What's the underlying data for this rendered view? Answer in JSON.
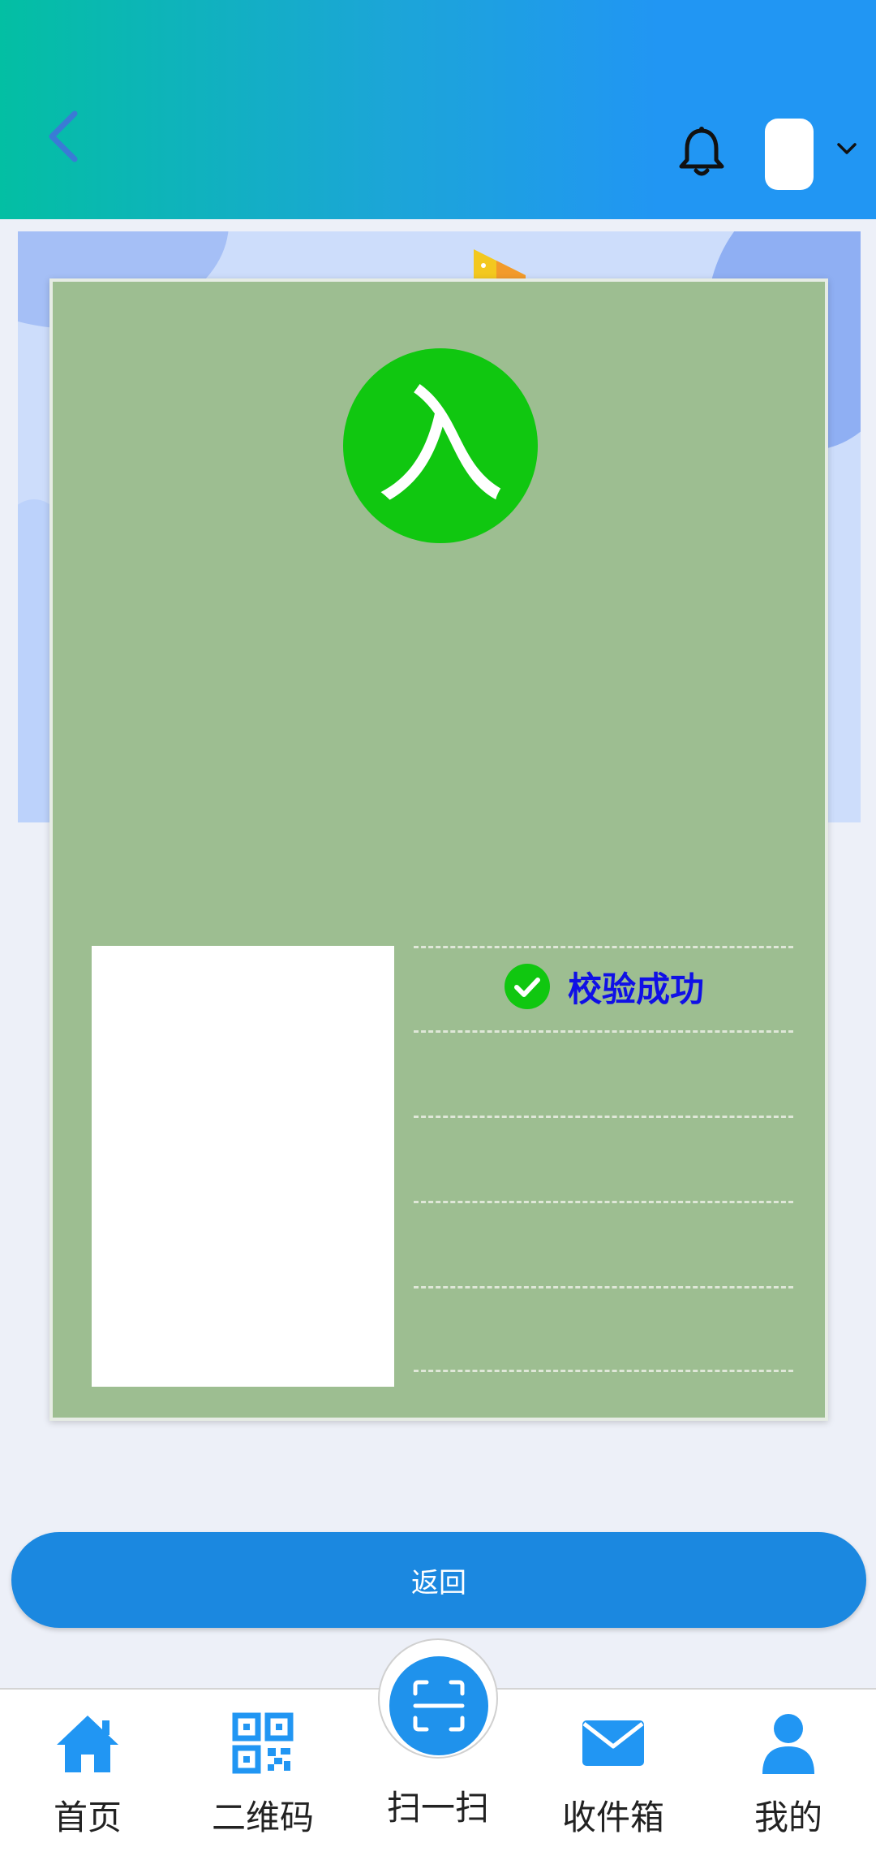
{
  "header": {
    "back_icon": "chevron-left-icon",
    "bell_icon": "bell-icon",
    "dropdown_icon": "chevron-down-icon"
  },
  "card": {
    "status_glyph": "入",
    "verify_icon": "check-circle-icon",
    "verify_text": "校验成功",
    "verify_color": "#1010e6",
    "card_color": "#9dbe91",
    "badge_color": "#10c710"
  },
  "actions": {
    "return_label": "返回"
  },
  "tabbar": {
    "items": [
      {
        "label": "首页",
        "icon": "home-icon"
      },
      {
        "label": "二维码",
        "icon": "qr-code-icon"
      },
      {
        "label": "扫一扫",
        "icon": "scan-icon"
      },
      {
        "label": "收件箱",
        "icon": "mail-icon"
      },
      {
        "label": "我的",
        "icon": "user-icon"
      }
    ]
  },
  "colors": {
    "accent": "#2196f3",
    "header_start": "#03bfa3",
    "button": "#1b88e0"
  }
}
